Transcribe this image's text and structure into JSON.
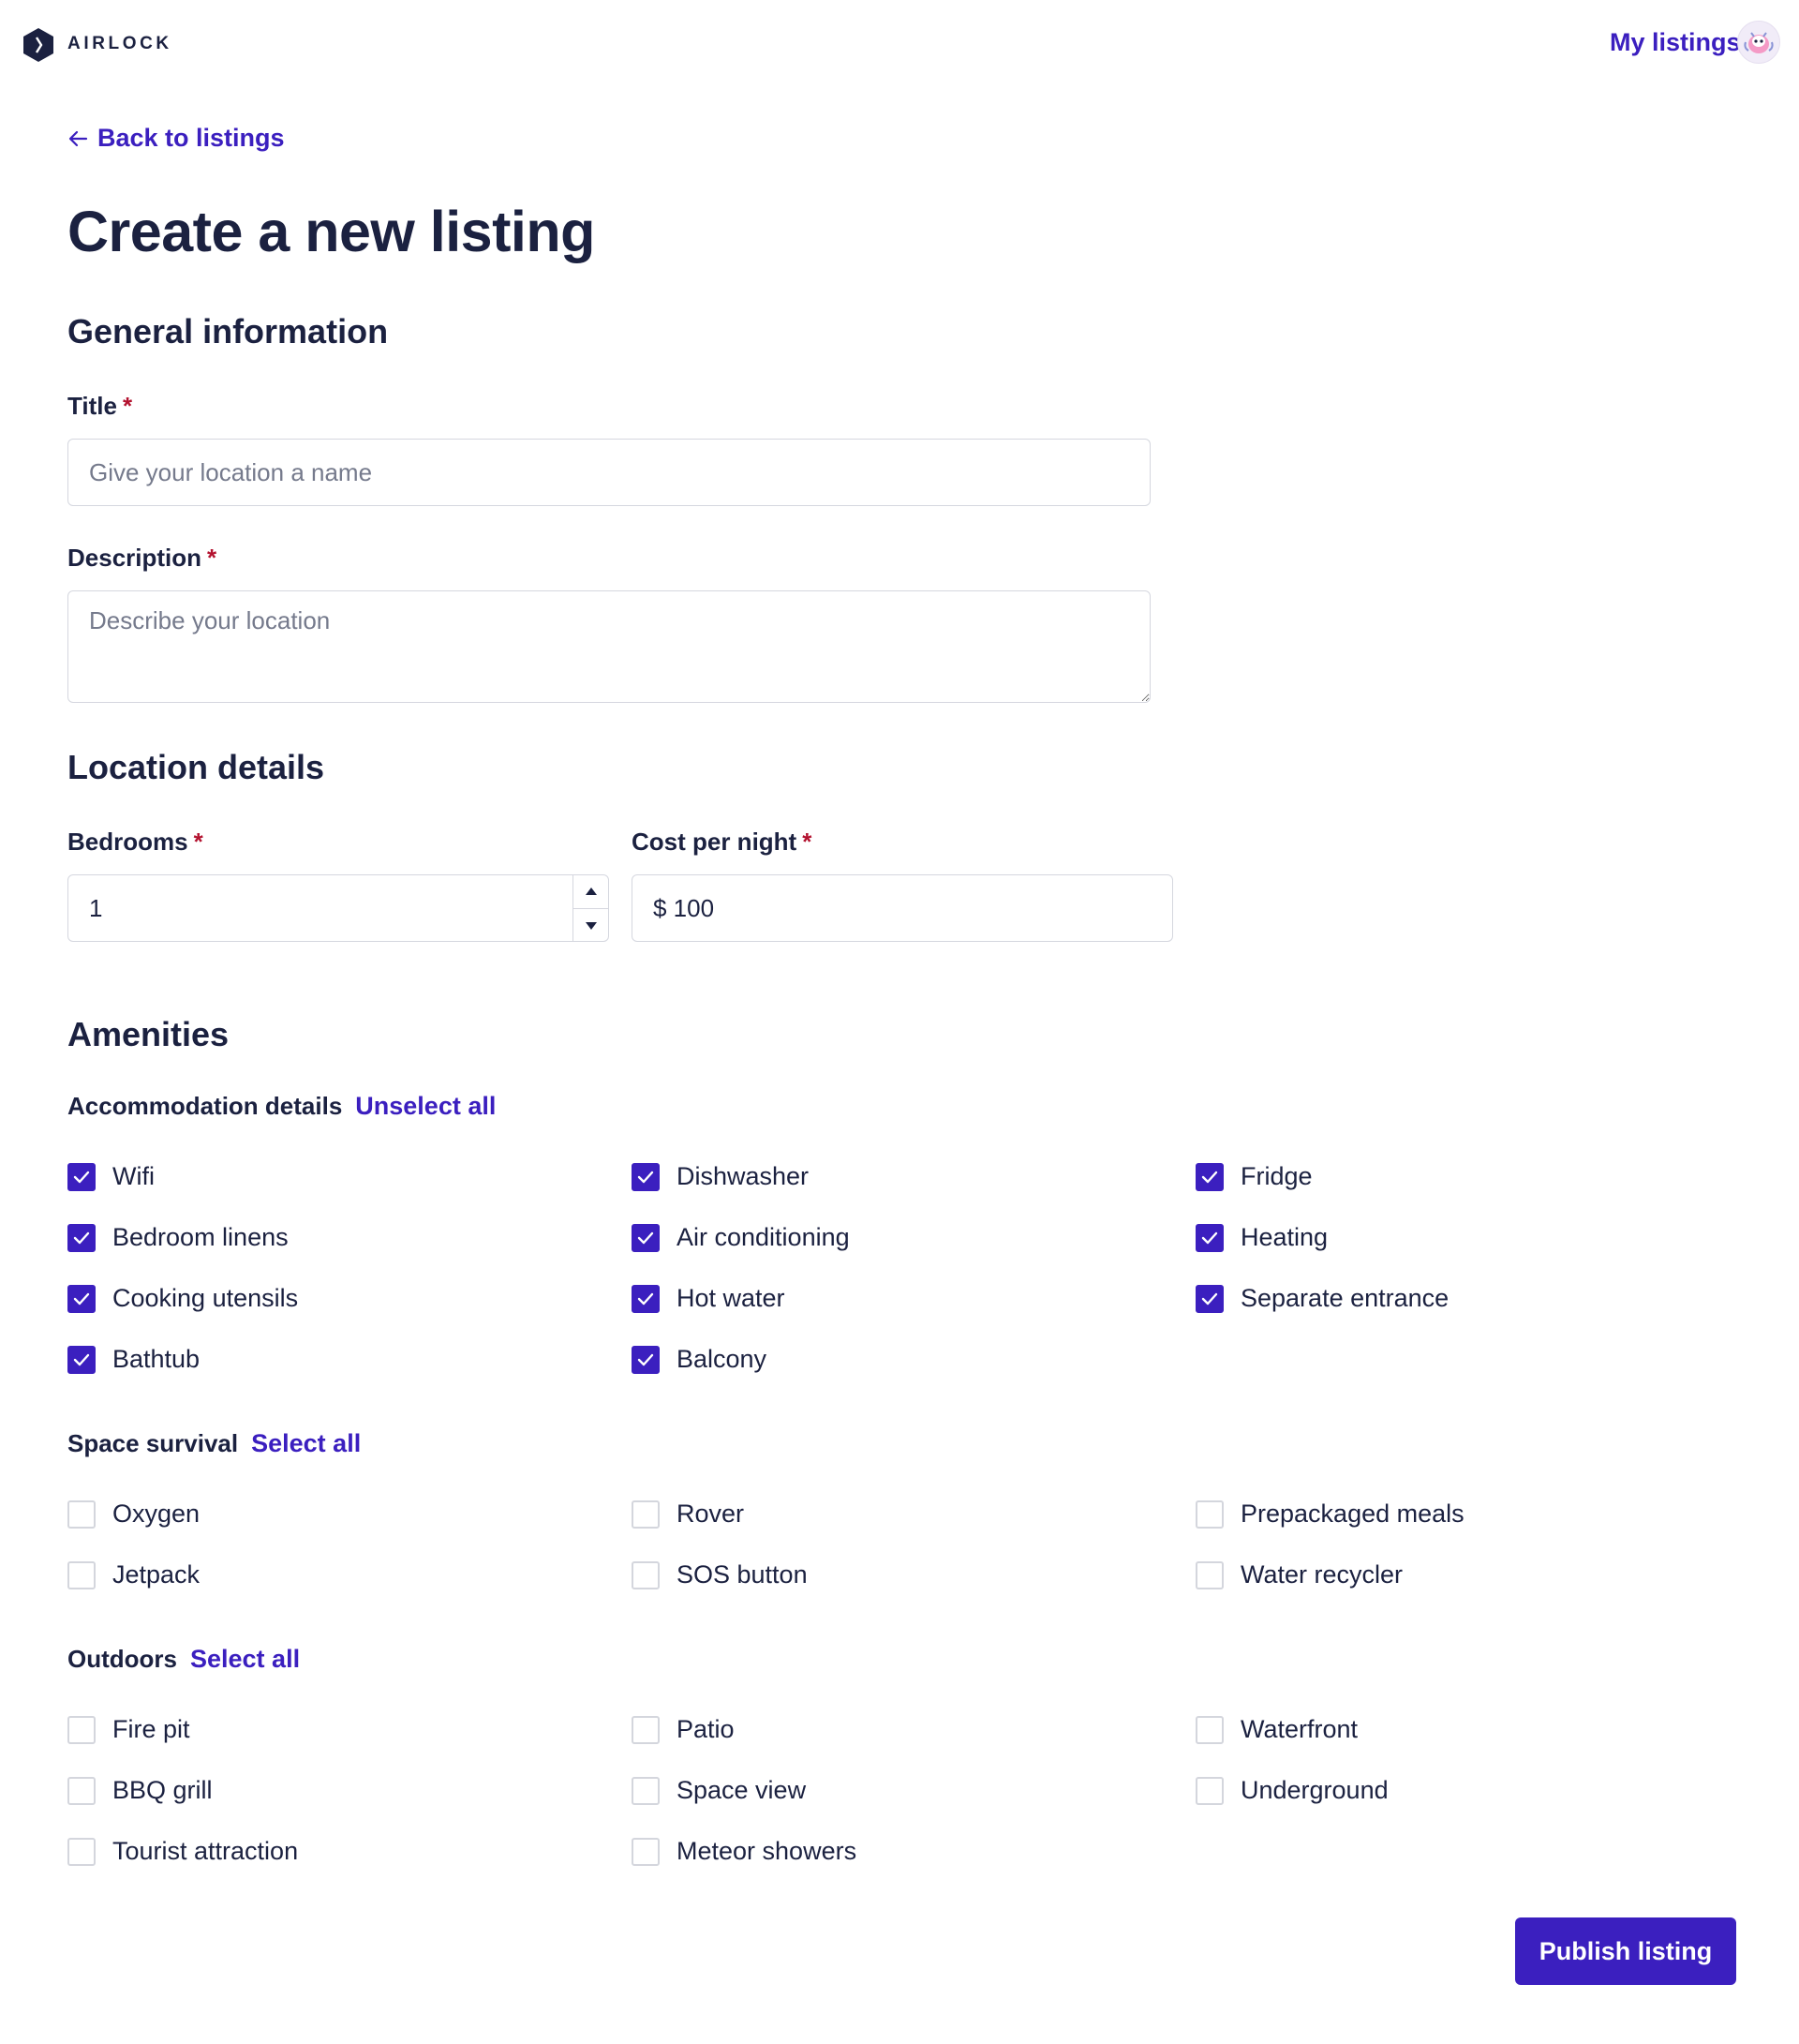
{
  "header": {
    "brand": "AIRLOCK",
    "nav_my_listings": "My listings"
  },
  "back_link": "Back to listings",
  "page_title": "Create a new listing",
  "general": {
    "section_title": "General information",
    "title_label": "Title",
    "title_placeholder": "Give your location a name",
    "description_label": "Description",
    "description_placeholder": "Describe your location",
    "required_mark": "*"
  },
  "location": {
    "section_title": "Location details",
    "bedrooms_label": "Bedrooms",
    "bedrooms_value": "1",
    "cost_label": "Cost per night",
    "cost_value": "$ 100"
  },
  "amenities": {
    "section_title": "Amenities",
    "groups": [
      {
        "title": "Accommodation details",
        "action": "Unselect all",
        "items": [
          {
            "label": "Wifi",
            "checked": true
          },
          {
            "label": "Dishwasher",
            "checked": true
          },
          {
            "label": "Fridge",
            "checked": true
          },
          {
            "label": "Bedroom linens",
            "checked": true
          },
          {
            "label": "Air conditioning",
            "checked": true
          },
          {
            "label": "Heating",
            "checked": true
          },
          {
            "label": "Cooking utensils",
            "checked": true
          },
          {
            "label": "Hot water",
            "checked": true
          },
          {
            "label": "Separate entrance",
            "checked": true
          },
          {
            "label": "Bathtub",
            "checked": true
          },
          {
            "label": "Balcony",
            "checked": true
          }
        ]
      },
      {
        "title": "Space survival",
        "action": "Select all",
        "items": [
          {
            "label": "Oxygen",
            "checked": false
          },
          {
            "label": "Rover",
            "checked": false
          },
          {
            "label": "Prepackaged meals",
            "checked": false
          },
          {
            "label": "Jetpack",
            "checked": false
          },
          {
            "label": "SOS button",
            "checked": false
          },
          {
            "label": "Water recycler",
            "checked": false
          }
        ]
      },
      {
        "title": "Outdoors",
        "action": "Select all",
        "items": [
          {
            "label": "Fire pit",
            "checked": false
          },
          {
            "label": "Patio",
            "checked": false
          },
          {
            "label": "Waterfront",
            "checked": false
          },
          {
            "label": "BBQ grill",
            "checked": false
          },
          {
            "label": "Space view",
            "checked": false
          },
          {
            "label": "Underground",
            "checked": false
          },
          {
            "label": "Tourist attraction",
            "checked": false
          },
          {
            "label": "Meteor showers",
            "checked": false
          }
        ]
      }
    ]
  },
  "publish_button": "Publish listing",
  "colors": {
    "accent": "#3b1fbf",
    "text": "#1b2140",
    "required": "#b3122f",
    "border": "#d5d7df"
  }
}
